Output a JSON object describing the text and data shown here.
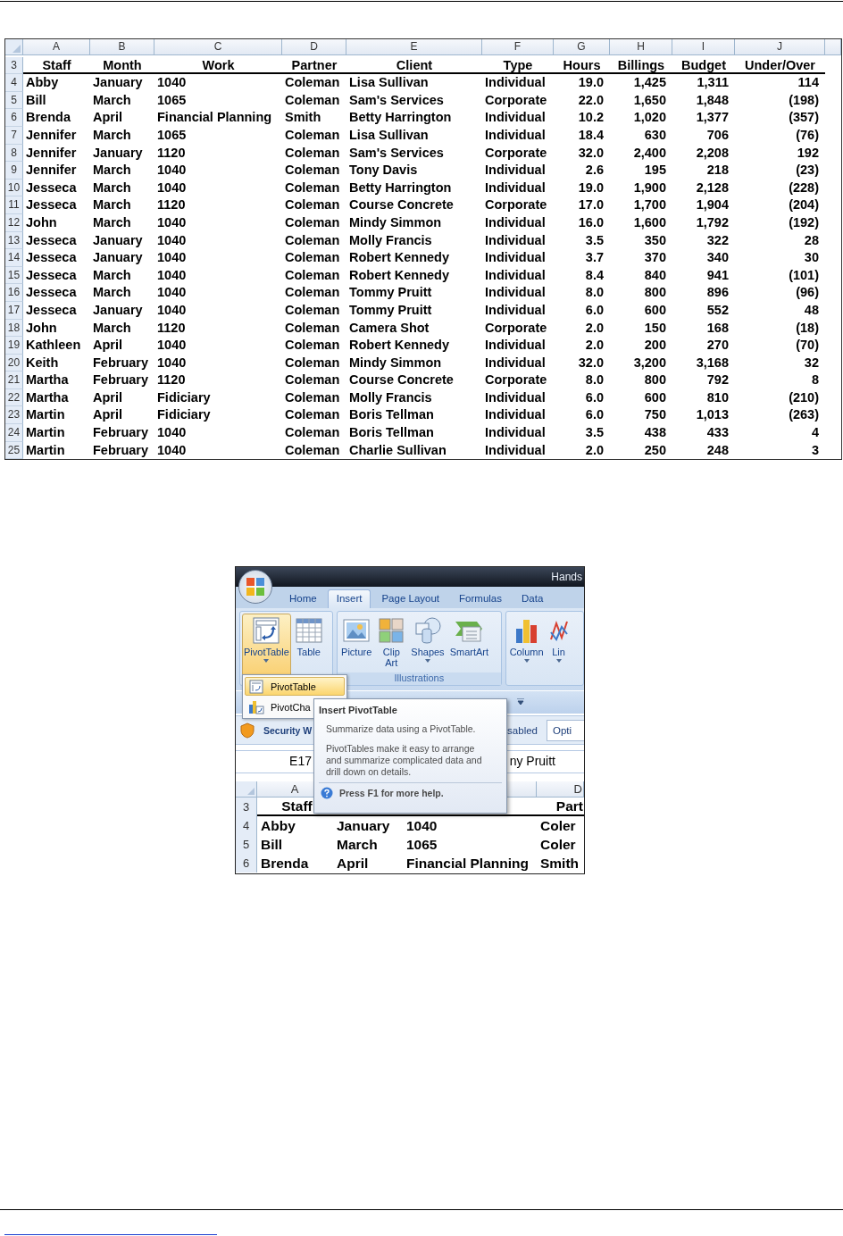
{
  "spreadsheet": {
    "columns": [
      "A",
      "B",
      "C",
      "D",
      "E",
      "F",
      "G",
      "H",
      "I",
      "J"
    ],
    "header": {
      "row": "3",
      "cells": [
        "Staff",
        "Month",
        "Work",
        "Partner",
        "Client",
        "Type",
        "Hours",
        "Billings",
        "Budget",
        "Under/Over"
      ]
    },
    "rows": [
      {
        "row": "4",
        "cells": [
          "Abby",
          "January",
          "1040",
          "Coleman",
          "Lisa Sullivan",
          "Individual",
          "19.0",
          "1,425",
          "1,311",
          "114"
        ]
      },
      {
        "row": "5",
        "cells": [
          "Bill",
          "March",
          "1065",
          "Coleman",
          "Sam's Services",
          "Corporate",
          "22.0",
          "1,650",
          "1,848",
          "(198)"
        ]
      },
      {
        "row": "6",
        "cells": [
          "Brenda",
          "April",
          "Financial Planning",
          "Smith",
          "Betty Harrington",
          "Individual",
          "10.2",
          "1,020",
          "1,377",
          "(357)"
        ]
      },
      {
        "row": "7",
        "cells": [
          "Jennifer",
          "March",
          "1065",
          "Coleman",
          "Lisa Sullivan",
          "Individual",
          "18.4",
          "630",
          "706",
          "(76)"
        ]
      },
      {
        "row": "8",
        "cells": [
          "Jennifer",
          "January",
          "1120",
          "Coleman",
          "Sam's Services",
          "Corporate",
          "32.0",
          "2,400",
          "2,208",
          "192"
        ]
      },
      {
        "row": "9",
        "cells": [
          "Jennifer",
          "March",
          "1040",
          "Coleman",
          "Tony Davis",
          "Individual",
          "2.6",
          "195",
          "218",
          "(23)"
        ]
      },
      {
        "row": "10",
        "cells": [
          "Jesseca",
          "March",
          "1040",
          "Coleman",
          "Betty Harrington",
          "Individual",
          "19.0",
          "1,900",
          "2,128",
          "(228)"
        ]
      },
      {
        "row": "11",
        "cells": [
          "Jesseca",
          "March",
          "1120",
          "Coleman",
          "Course Concrete",
          "Corporate",
          "17.0",
          "1,700",
          "1,904",
          "(204)"
        ]
      },
      {
        "row": "12",
        "cells": [
          "John",
          "March",
          "1040",
          "Coleman",
          "Mindy Simmon",
          "Individual",
          "16.0",
          "1,600",
          "1,792",
          "(192)"
        ]
      },
      {
        "row": "13",
        "cells": [
          "Jesseca",
          "January",
          "1040",
          "Coleman",
          "Molly Francis",
          "Individual",
          "3.5",
          "350",
          "322",
          "28"
        ]
      },
      {
        "row": "14",
        "cells": [
          "Jesseca",
          "January",
          "1040",
          "Coleman",
          "Robert Kennedy",
          "Individual",
          "3.7",
          "370",
          "340",
          "30"
        ]
      },
      {
        "row": "15",
        "cells": [
          "Jesseca",
          "March",
          "1040",
          "Coleman",
          "Robert Kennedy",
          "Individual",
          "8.4",
          "840",
          "941",
          "(101)"
        ]
      },
      {
        "row": "16",
        "cells": [
          "Jesseca",
          "March",
          "1040",
          "Coleman",
          "Tommy Pruitt",
          "Individual",
          "8.0",
          "800",
          "896",
          "(96)"
        ]
      },
      {
        "row": "17",
        "cells": [
          "Jesseca",
          "January",
          "1040",
          "Coleman",
          "Tommy Pruitt",
          "Individual",
          "6.0",
          "600",
          "552",
          "48"
        ]
      },
      {
        "row": "18",
        "cells": [
          "John",
          "March",
          "1120",
          "Coleman",
          "Camera Shot",
          "Corporate",
          "2.0",
          "150",
          "168",
          "(18)"
        ]
      },
      {
        "row": "19",
        "cells": [
          "Kathleen",
          "April",
          "1040",
          "Coleman",
          "Robert Kennedy",
          "Individual",
          "2.0",
          "200",
          "270",
          "(70)"
        ]
      },
      {
        "row": "20",
        "cells": [
          "Keith",
          "February",
          "1040",
          "Coleman",
          "Mindy Simmon",
          "Individual",
          "32.0",
          "3,200",
          "3,168",
          "32"
        ]
      },
      {
        "row": "21",
        "cells": [
          "Martha",
          "February",
          "1120",
          "Coleman",
          "Course Concrete",
          "Corporate",
          "8.0",
          "800",
          "792",
          "8"
        ]
      },
      {
        "row": "22",
        "cells": [
          "Martha",
          "April",
          "Fidiciary",
          "Coleman",
          "Molly Francis",
          "Individual",
          "6.0",
          "600",
          "810",
          "(210)"
        ]
      },
      {
        "row": "23",
        "cells": [
          "Martin",
          "April",
          "Fidiciary",
          "Coleman",
          "Boris Tellman",
          "Individual",
          "6.0",
          "750",
          "1,013",
          "(263)"
        ]
      },
      {
        "row": "24",
        "cells": [
          "Martin",
          "February",
          "1040",
          "Coleman",
          "Boris Tellman",
          "Individual",
          "3.5",
          "438",
          "433",
          "4"
        ]
      },
      {
        "row": "25",
        "cells": [
          "Martin",
          "February",
          "1040",
          "Coleman",
          "Charlie Sullivan",
          "Individual",
          "2.0",
          "250",
          "248",
          "3"
        ]
      }
    ]
  },
  "excel_window": {
    "title": "Hands",
    "tabs": [
      {
        "label": "Home",
        "selected": false
      },
      {
        "label": "Insert",
        "selected": true
      },
      {
        "label": "Page Layout",
        "selected": false
      },
      {
        "label": "Formulas",
        "selected": false
      },
      {
        "label": "Data",
        "selected": false
      }
    ],
    "ribbon_groups": [
      {
        "buttons": [
          {
            "kind": "pivottable",
            "label": "PivotTable",
            "dropdown": true,
            "pressed": true
          },
          {
            "kind": "table",
            "label": "Table",
            "dropdown": false,
            "pressed": false
          }
        ]
      },
      {
        "label": "Illustrations",
        "buttons": [
          {
            "kind": "picture",
            "label": "Picture",
            "dropdown": false,
            "pressed": false
          },
          {
            "kind": "clipart",
            "label": "Clip Art",
            "dropdown": false,
            "pressed": false
          },
          {
            "kind": "shapes",
            "label": "Shapes",
            "dropdown": true,
            "pressed": false
          },
          {
            "kind": "smartart",
            "label": "SmartArt",
            "dropdown": false,
            "pressed": false
          }
        ]
      },
      {
        "buttons": [
          {
            "kind": "column",
            "label": "Column",
            "dropdown": true,
            "pressed": false
          },
          {
            "kind": "line",
            "label": "Lin",
            "dropdown": true,
            "pressed": false
          }
        ]
      }
    ],
    "dropdown_menu": [
      {
        "kind": "pivottable",
        "label": "PivotTable",
        "selected": true
      },
      {
        "kind": "pivotchart",
        "label": "PivotCha",
        "selected": false
      }
    ],
    "security_bar": {
      "label": "Security W",
      "message": "sabled",
      "button": "Opti"
    },
    "formula_bar": {
      "name_box": "E17",
      "value": "ny Pruitt"
    },
    "sheet": {
      "columns": [
        "A",
        "",
        "",
        "D"
      ],
      "header": {
        "row": "3",
        "cells": [
          "Staff",
          "",
          "",
          "Part"
        ]
      },
      "rows": [
        {
          "row": "4",
          "cells": [
            "Abby",
            "January",
            "1040",
            "Coler"
          ]
        },
        {
          "row": "5",
          "cells": [
            "Bill",
            "March",
            "1065",
            "Coler"
          ]
        },
        {
          "row": "6",
          "cells": [
            "Brenda",
            "April",
            "Financial Planning",
            "Smith"
          ]
        }
      ]
    },
    "tooltip": {
      "title": "Insert PivotTable",
      "summary": "Summarize data using a PivotTable.",
      "description": "PivotTables make it easy to arrange and summarize complicated data and drill down on details.",
      "help": "Press F1 for more help."
    }
  }
}
